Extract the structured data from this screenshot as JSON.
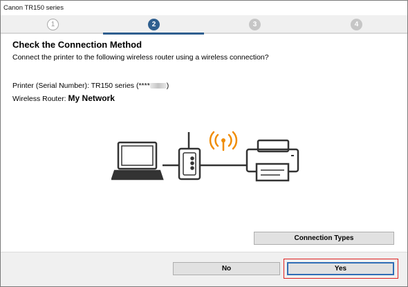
{
  "window": {
    "title": "Canon TR150 series"
  },
  "steps": [
    {
      "label": "1",
      "state": "done"
    },
    {
      "label": "2",
      "state": "active"
    },
    {
      "label": "3",
      "state": "pending"
    },
    {
      "label": "4",
      "state": "pending"
    }
  ],
  "main": {
    "heading": "Check the Connection Method",
    "prompt": "Connect the printer to the following wireless router using a wireless connection?",
    "printer_label": "Printer (Serial Number): TR150 series (****",
    "printer_suffix": ")",
    "router_label": "Wireless Router: ",
    "router_value": "My Network"
  },
  "diagram": {
    "icons": [
      "laptop-icon",
      "router-icon",
      "wifi-signal-icon",
      "printer-icon"
    ],
    "wifi_color": "#f08c00"
  },
  "buttons": {
    "connection_types": "Connection Types",
    "no": "No",
    "yes": "Yes"
  },
  "colors": {
    "accent": "#2f5f8f",
    "highlight": "#e02020"
  }
}
